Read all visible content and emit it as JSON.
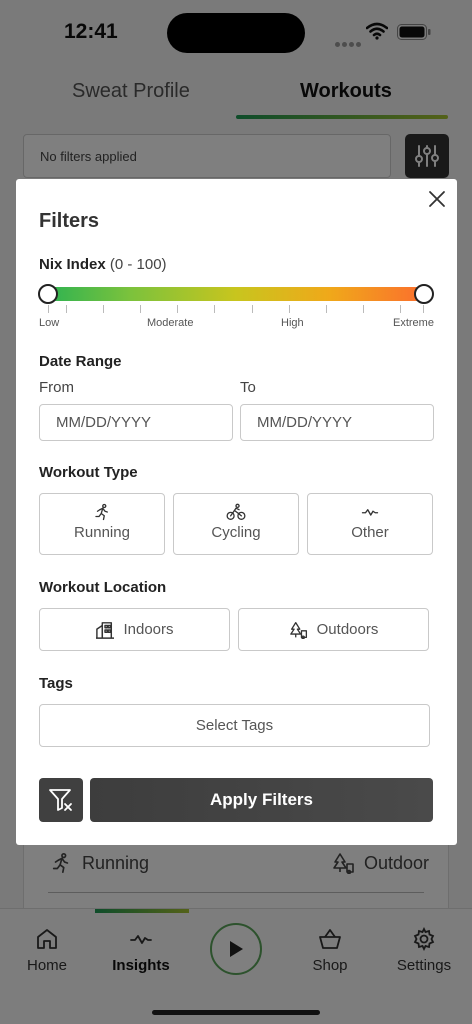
{
  "status_bar": {
    "time": "12:41"
  },
  "top_tabs": [
    {
      "label": "Sweat Profile"
    },
    {
      "label": "Workouts"
    }
  ],
  "filter_bar": {
    "text": "No filters applied"
  },
  "background_row": {
    "type": "Running",
    "location": "Outdoor"
  },
  "bottom_nav": {
    "items": [
      {
        "label": "Home",
        "icon": "home-icon"
      },
      {
        "label": "Insights",
        "icon": "activity-icon"
      },
      {
        "label": "Shop",
        "icon": "basket-icon"
      },
      {
        "label": "Settings",
        "icon": "gear-icon"
      }
    ]
  },
  "modal": {
    "title": "Filters",
    "nix_index": {
      "label": "Nix Index",
      "range_text": "(0 - 100)",
      "min": 0,
      "max": 100,
      "scale_labels": [
        "Low",
        "Moderate",
        "High",
        "Extreme"
      ]
    },
    "date_range": {
      "label": "Date Range",
      "from_label": "From",
      "to_label": "To",
      "from_placeholder": "MM/DD/YYYY",
      "to_placeholder": "MM/DD/YYYY"
    },
    "workout_type": {
      "label": "Workout Type",
      "options": [
        {
          "label": "Running",
          "icon": "running-icon"
        },
        {
          "label": "Cycling",
          "icon": "cycling-icon"
        },
        {
          "label": "Other",
          "icon": "activity-icon"
        }
      ]
    },
    "workout_location": {
      "label": "Workout Location",
      "options": [
        {
          "label": "Indoors",
          "icon": "building-icon"
        },
        {
          "label": "Outdoors",
          "icon": "trees-icon"
        }
      ]
    },
    "tags": {
      "label": "Tags",
      "button_label": "Select Tags"
    },
    "apply_label": "Apply Filters"
  },
  "colors": {
    "accent_green": "#1e9a55",
    "accent_lime": "#a8c432",
    "dark_button": "#404040",
    "gradient": [
      "#2fb351",
      "#c8c51e",
      "#fb6f2d"
    ]
  }
}
